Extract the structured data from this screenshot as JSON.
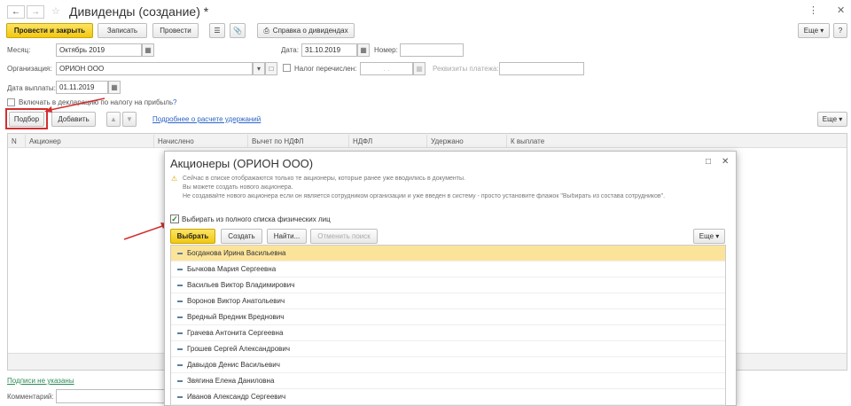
{
  "window": {
    "title": "Дивиденды (создание) *"
  },
  "toolbar": {
    "post_close": "Провести и закрыть",
    "save": "Записать",
    "post": "Провести",
    "report": "Справка о дивидендах",
    "more": "Еще"
  },
  "form": {
    "month_label": "Месяц:",
    "month_value": "Октябрь 2019",
    "date_label": "Дата:",
    "date_value": "31.10.2019",
    "number_label": "Номер:",
    "number_value": "",
    "org_label": "Организация:",
    "org_value": "ОРИОН ООО",
    "tax_paid_label": "Налог перечислен:",
    "tax_paid_date": ". .",
    "payment_details_label": "Реквизиты платежа:",
    "pay_date_label": "Дата выплаты:",
    "pay_date_value": "01.11.2019",
    "include_decl_label": "Включать в декларацию по налогу на прибыль",
    "help": "?"
  },
  "table_toolbar": {
    "select": "Подбор",
    "add": "Добавить",
    "link": "Подробнее о расчете удержаний",
    "more": "Еще"
  },
  "table": {
    "columns": [
      "N",
      "Акционер",
      "Начислено",
      "Вычет по НДФЛ",
      "НДФЛ",
      "Удержано",
      "К выплате"
    ]
  },
  "footer": {
    "signatures_link": "Подписи не указаны",
    "comment_label": "Комментарий:"
  },
  "dialog": {
    "title": "Акционеры (ОРИОН ООО)",
    "info_line1": "Сейчас в списке отображаются только те акционеры, которые ранее уже вводились в документы.",
    "info_line2": "Вы можете создать нового акционера.",
    "info_line3": "Не создавайте нового акционера если он является сотрудником организации и уже введен в систему - просто установите флажок \"Выбирать из состава сотрудников\".",
    "checkbox_label": "Выбирать из полного списка физических лиц",
    "select": "Выбрать",
    "create": "Создать",
    "find": "Найти...",
    "cancel_search": "Отменить поиск",
    "more": "Еще",
    "items": [
      "Богданова Ирина Васильевна",
      "Бычкова Мария Сергеевна",
      "Васильев Виктор Владимирович",
      "Воронов Виктор Анатольевич",
      "Вредный Вредник Вреднович",
      "Грачева Антонита Сергеевна",
      "Грошев Сергей Александрович",
      "Давыдов Денис Васильевич",
      "Звягина Елена Даниловна",
      "Иванов Александр Сергеевич"
    ]
  },
  "colors": {
    "accent": "#f2c811",
    "annotation": "#d32f2f",
    "link": "#2c64c6"
  }
}
